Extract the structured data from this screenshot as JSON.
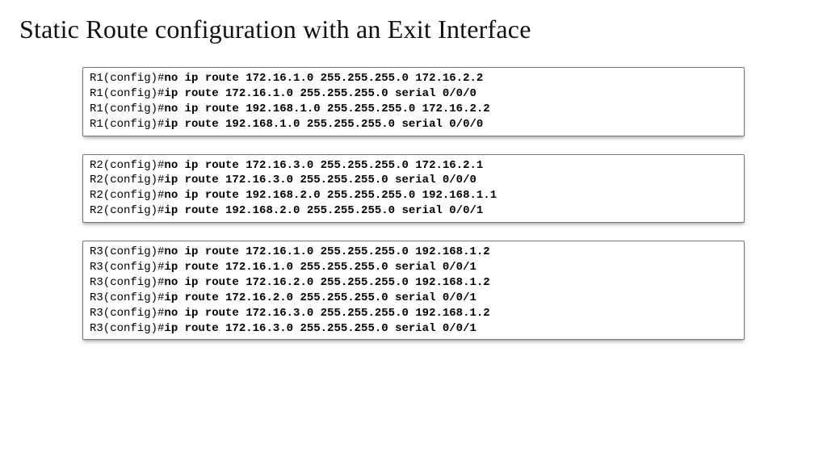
{
  "title": "Static Route configuration with an Exit Interface",
  "blocks": [
    {
      "router": "R1",
      "lines": [
        {
          "prompt": "R1(config)#",
          "command": "no ip route 172.16.1.0 255.255.255.0 172.16.2.2"
        },
        {
          "prompt": "R1(config)#",
          "command": "ip route 172.16.1.0 255.255.255.0 serial 0/0/0"
        },
        {
          "prompt": "R1(config)#",
          "command": "no ip route 192.168.1.0 255.255.255.0 172.16.2.2"
        },
        {
          "prompt": "R1(config)#",
          "command": "ip route 192.168.1.0 255.255.255.0 serial 0/0/0"
        }
      ]
    },
    {
      "router": "R2",
      "lines": [
        {
          "prompt": "R2(config)#",
          "command": "no ip route 172.16.3.0 255.255.255.0 172.16.2.1"
        },
        {
          "prompt": "R2(config)#",
          "command": "ip route 172.16.3.0 255.255.255.0 serial 0/0/0"
        },
        {
          "prompt": "R2(config)#",
          "command": "no ip route 192.168.2.0 255.255.255.0 192.168.1.1"
        },
        {
          "prompt": "R2(config)#",
          "command": "ip route 192.168.2.0 255.255.255.0 serial 0/0/1"
        }
      ]
    },
    {
      "router": "R3",
      "lines": [
        {
          "prompt": "R3(config)#",
          "command": "no ip route 172.16.1.0 255.255.255.0 192.168.1.2"
        },
        {
          "prompt": "R3(config)#",
          "command": "ip route 172.16.1.0 255.255.255.0 serial 0/0/1"
        },
        {
          "prompt": "R3(config)#",
          "command": "no ip route 172.16.2.0 255.255.255.0 192.168.1.2"
        },
        {
          "prompt": "R3(config)#",
          "command": "ip route 172.16.2.0 255.255.255.0 serial 0/0/1"
        },
        {
          "prompt": "R3(config)#",
          "command": "no ip route 172.16.3.0 255.255.255.0 192.168.1.2"
        },
        {
          "prompt": "R3(config)#",
          "command": "ip route 172.16.3.0 255.255.255.0 serial 0/0/1"
        }
      ]
    }
  ]
}
